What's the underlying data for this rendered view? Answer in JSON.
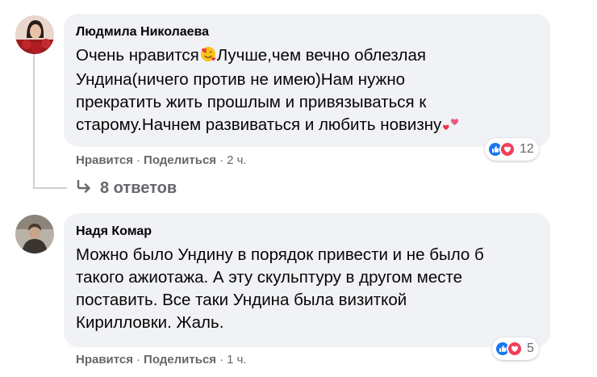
{
  "comments": [
    {
      "author": "Людмила Николаева",
      "lines": [
        "Очень нравится",
        "Лучше,чем вечно облезлая",
        "Ундина(ничего против не имею)Нам нужно",
        "прекратить жить прошлым и привязываться к",
        "старому.Начнем развиваться и любить новизну"
      ],
      "emoji_inline": "smiling-face-with-hearts",
      "emoji_end": "two-hearts",
      "like_label": "Нравится",
      "share_label": "Поделиться",
      "separator": "·",
      "time": "2 ч.",
      "reaction_count": "12",
      "replies_label": "8 ответов"
    },
    {
      "author": "Надя Комар",
      "lines": [
        "Можно было Ундину в порядок привести и не было б",
        "такого ажиотажа. А эту скульптуру в другом месте",
        "поставить. Все таки Ундина была визиткой",
        "Кирилловки. Жаль."
      ],
      "like_label": "Нравится",
      "share_label": "Поделиться",
      "separator": "·",
      "time": "1 ч.",
      "reaction_count": "5"
    }
  ],
  "colors": {
    "bubble": "#f0f2f5",
    "secondary_text": "#65676b",
    "like_blue": "#1877f2",
    "love_red": "#f33e58"
  }
}
